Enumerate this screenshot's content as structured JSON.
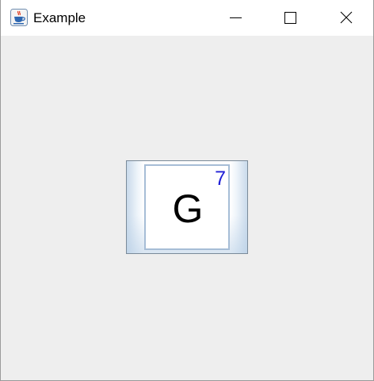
{
  "window": {
    "title": "Example",
    "icon": "java-coffee-cup-icon",
    "controls": {
      "minimize_icon": "minimize-icon",
      "maximize_icon": "maximize-icon",
      "close_icon": "close-icon"
    }
  },
  "tile": {
    "letter": "G",
    "score": "7"
  },
  "colors": {
    "content_background": "#eeeeee",
    "titlebar_background": "#ffffff",
    "score_color": "#1f1fd6",
    "tile_border": "#a6bdd6",
    "button_border": "#7a8a99"
  }
}
